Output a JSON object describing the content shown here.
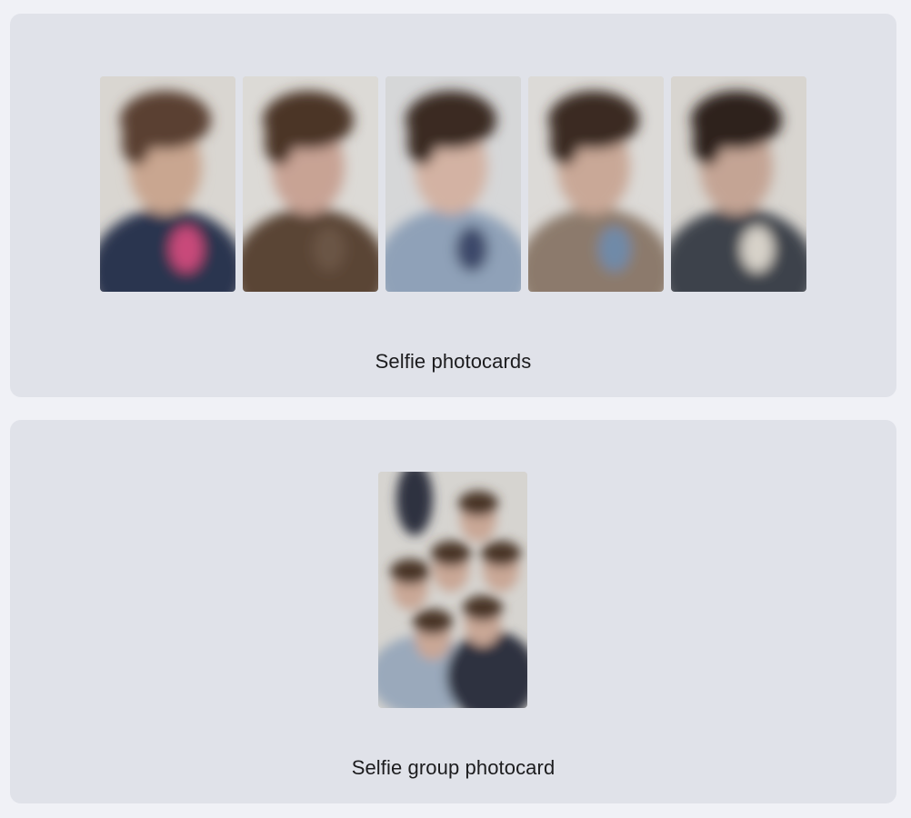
{
  "sections": [
    {
      "caption": "Selfie photocards",
      "cards": [
        {
          "name": "photocard-1",
          "colors": {
            "bg": "#d9d6d1",
            "hair": "#5a4130",
            "skin": "#c9a690",
            "shirt": "#2c3550",
            "accent": "#c94a7a"
          }
        },
        {
          "name": "photocard-2",
          "colors": {
            "bg": "#dcdad6",
            "hair": "#4b3526",
            "skin": "#c8a394",
            "shirt": "#5a4535",
            "accent": "#6b5544"
          }
        },
        {
          "name": "photocard-3",
          "colors": {
            "bg": "#d6d7d8",
            "hair": "#3b2b22",
            "skin": "#d3b2a3",
            "shirt": "#8fa1b8",
            "accent": "#3d4a6a"
          }
        },
        {
          "name": "photocard-4",
          "colors": {
            "bg": "#dcdad7",
            "hair": "#3a2a20",
            "skin": "#c9a897",
            "shirt": "#8c7a6c",
            "accent": "#6f8aa8"
          }
        },
        {
          "name": "photocard-5",
          "colors": {
            "bg": "#d8d5d0",
            "hair": "#2d241f",
            "skin": "#c4a494",
            "shirt": "#3e434c",
            "accent": "#d7d2c9"
          }
        }
      ]
    },
    {
      "caption": "Selfie group photocard",
      "cards": [
        {
          "name": "group-photocard",
          "colors": {
            "bg": "#d6d4d0",
            "hair": "#4a3527",
            "skin": "#c9a796",
            "shirt": "#9aa9bb",
            "accent": "#2f3340"
          }
        }
      ]
    }
  ]
}
